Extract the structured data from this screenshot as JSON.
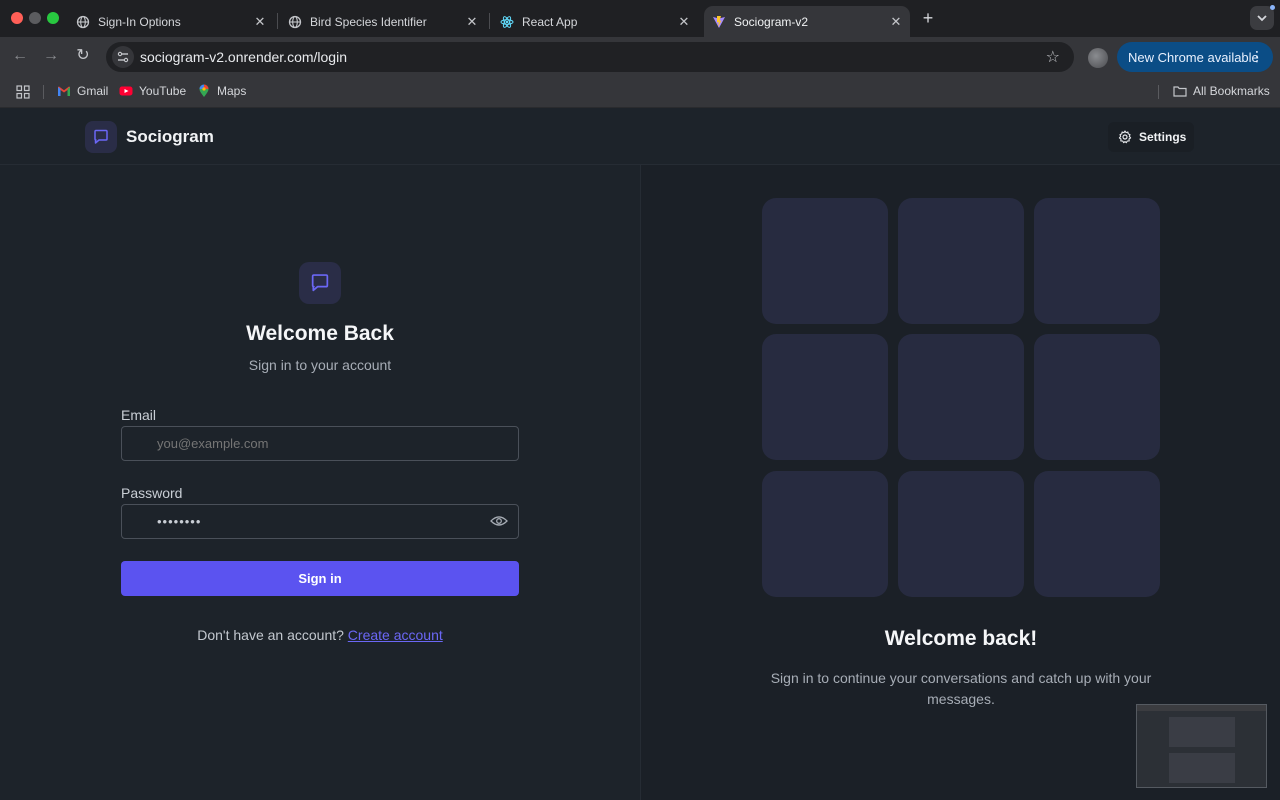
{
  "browser": {
    "tabs": [
      {
        "label": "Sign-In Options",
        "icon": "globe-icon"
      },
      {
        "label": "Bird Species Identifier",
        "icon": "globe-icon"
      },
      {
        "label": "React App",
        "icon": "react-icon"
      },
      {
        "label": "Sociogram-v2",
        "icon": "vite-icon",
        "active": true
      }
    ],
    "url": "sociogram-v2.onrender.com/login",
    "update_button": "New Chrome available",
    "bookmarks": [
      {
        "label": "Gmail",
        "icon": "gmail-icon"
      },
      {
        "label": "YouTube",
        "icon": "youtube-icon"
      },
      {
        "label": "Maps",
        "icon": "maps-icon"
      }
    ],
    "all_bookmarks": "All Bookmarks"
  },
  "app": {
    "brand": "Sociogram",
    "settings_label": "Settings",
    "accent": "#5b53f0"
  },
  "login": {
    "title": "Welcome Back",
    "subtitle": "Sign in to your account",
    "email_label": "Email",
    "email_placeholder": "you@example.com",
    "email_value": "",
    "password_label": "Password",
    "password_value": "••••••••",
    "submit": "Sign in",
    "no_account": "Don't have an account?",
    "create_account": "Create account"
  },
  "hero": {
    "title": "Welcome back!",
    "text": "Sign in to continue your conversations and catch up with your messages.",
    "tile_count": 9
  }
}
